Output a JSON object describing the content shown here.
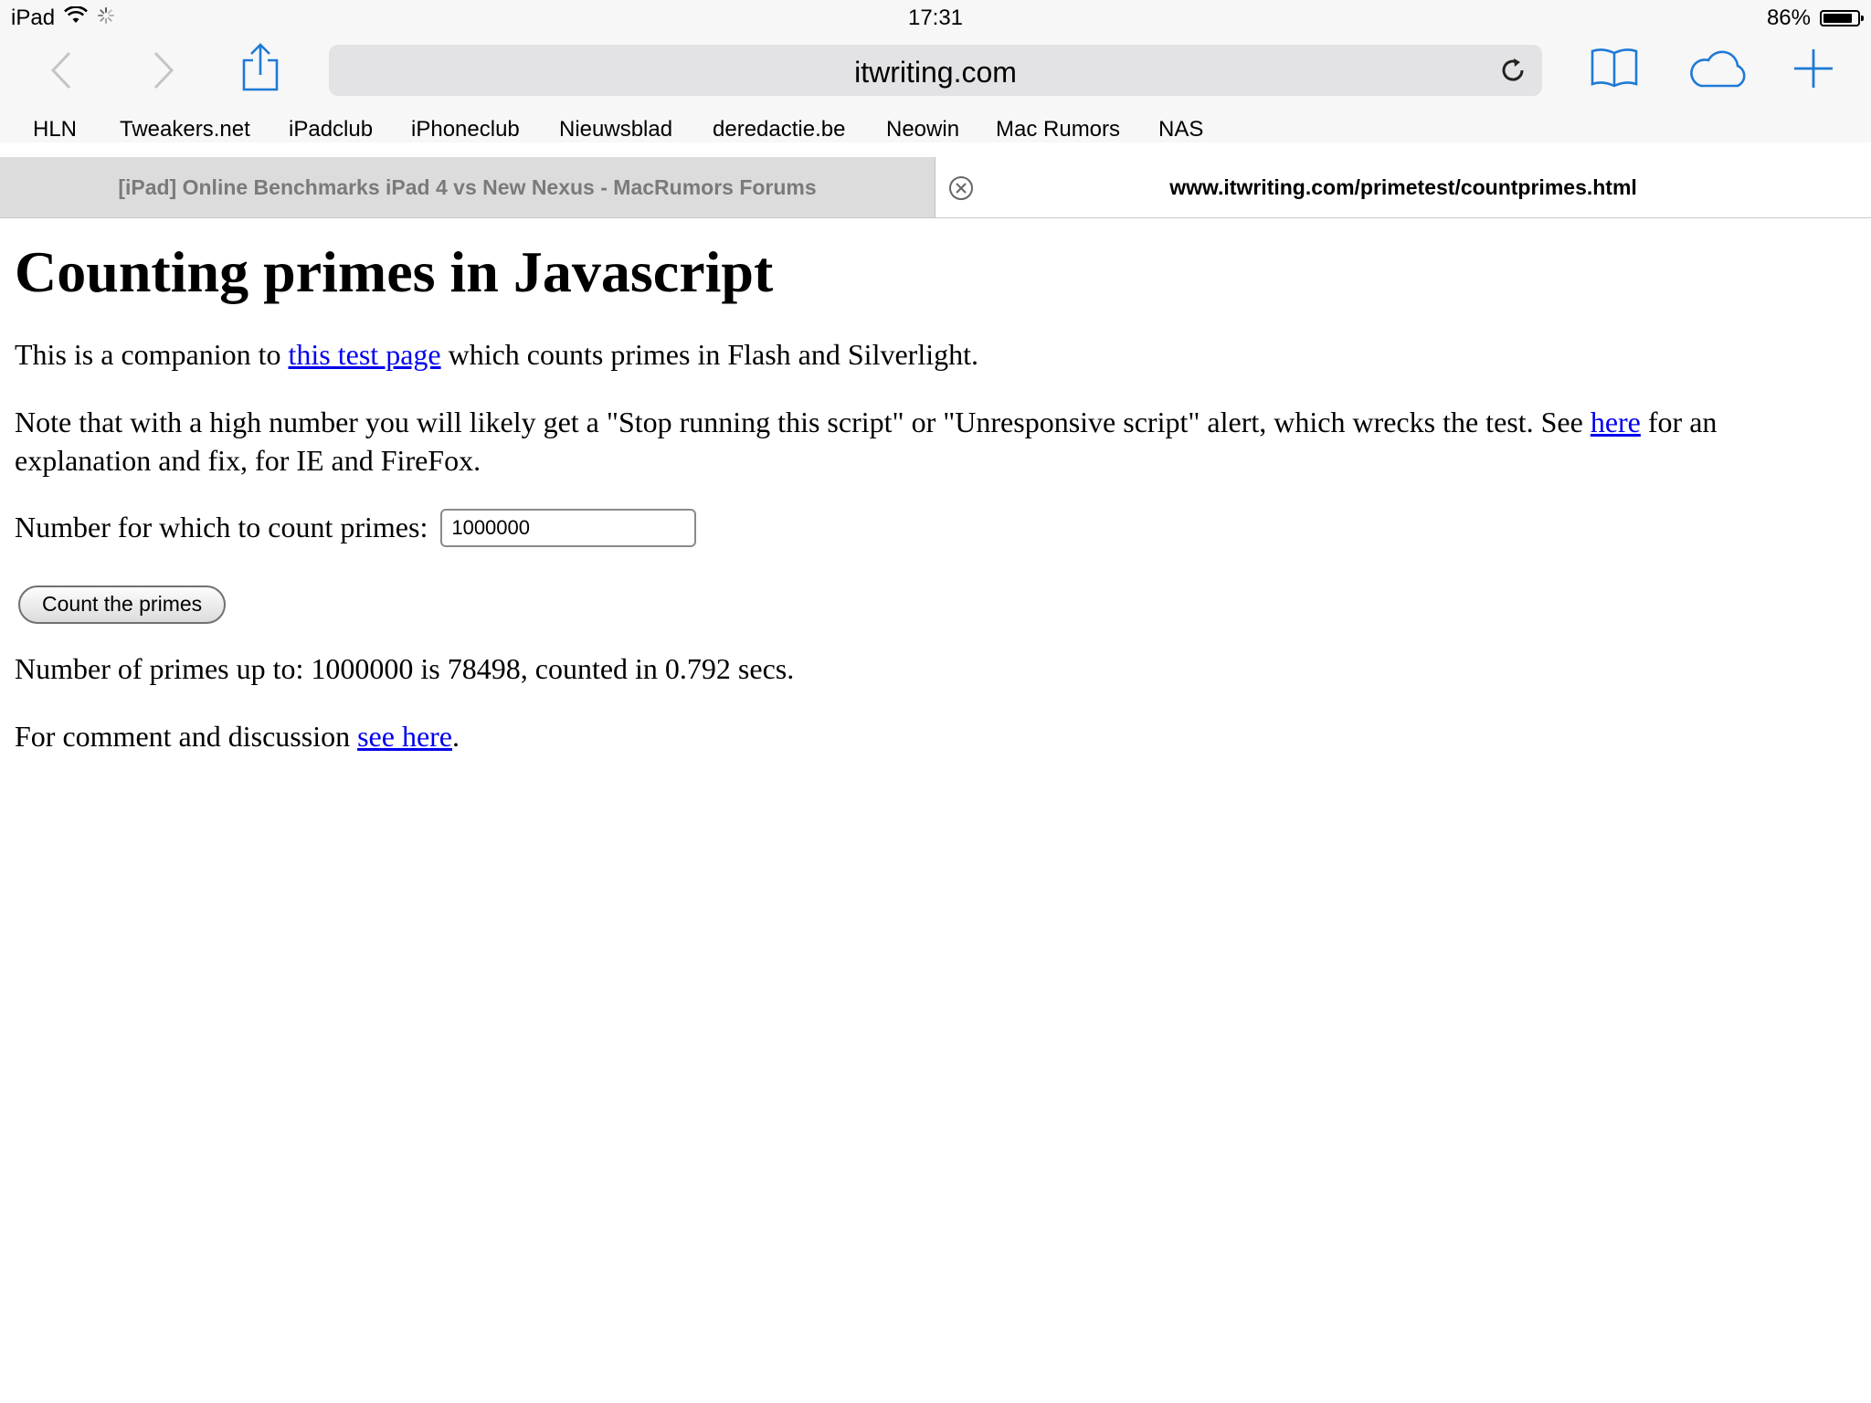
{
  "status_bar": {
    "device": "iPad",
    "time": "17:31",
    "battery_percent_text": "86%",
    "battery_level": 0.86
  },
  "toolbar": {
    "address": "itwriting.com",
    "icons": {
      "back": "back-chevron-icon",
      "forward": "forward-chevron-icon",
      "share": "share-icon",
      "reload": "reload-icon",
      "bookmarks": "book-icon",
      "icloud_tabs": "cloud-icon",
      "new_tab": "plus-icon"
    },
    "accent_color": "#1e7ad6"
  },
  "bookmarks_bar": [
    "HLN",
    "Tweakers.net",
    "iPadclub",
    "iPhoneclub",
    "Nieuwsblad",
    "deredactie.be",
    "Neowin",
    "Mac Rumors",
    "NAS"
  ],
  "tabs": [
    {
      "title": "[iPad] Online Benchmarks iPad 4 vs New Nexus - MacRumors Forums",
      "active": false
    },
    {
      "title": "www.itwriting.com/primetest/countprimes.html",
      "active": true
    }
  ],
  "page": {
    "heading": "Counting primes in Javascript",
    "intro_before": "This is a companion to ",
    "intro_link": "this test page",
    "intro_after": " which counts primes in Flash and Silverlight.",
    "note_before": "Note that with a high number you will likely get a \"Stop running this script\" or \"Unresponsive script\" alert, which wrecks the test. See ",
    "note_link": "here",
    "note_after": " for an explanation and fix, for IE and FireFox.",
    "input_label": "Number for which to count primes:",
    "input_value": "1000000",
    "button_label": "Count the primes",
    "result_text": "Number of primes up to: 1000000 is 78498, counted in 0.792 secs.",
    "comment_before": "For comment and discussion ",
    "comment_link": "see here",
    "comment_after": ".",
    "link_color": "#0000ee"
  }
}
